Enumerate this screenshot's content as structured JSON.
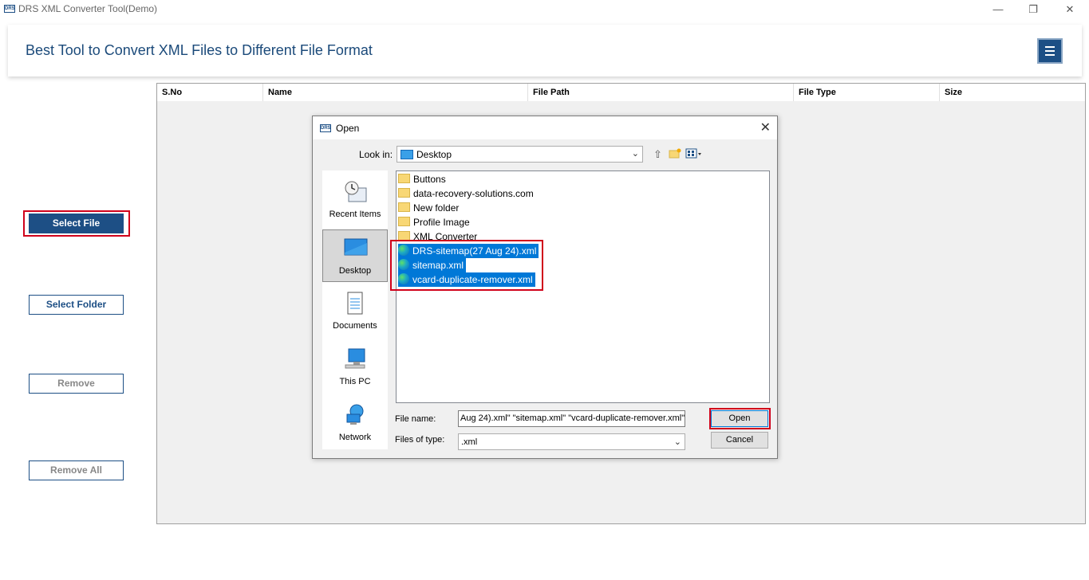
{
  "app": {
    "logo_text": "DRS",
    "title": "DRS XML Converter Tool(Demo)",
    "banner_title": "Best Tool to Convert XML Files to Different File Format",
    "window_controls": {
      "minimize": "—",
      "restore": "❐",
      "close": "✕"
    }
  },
  "sidebar": {
    "select_file": "Select File",
    "select_folder": "Select Folder",
    "remove": "Remove",
    "remove_all": "Remove All"
  },
  "grid": {
    "columns": [
      "S.No",
      "Name",
      "File Path",
      "File Type",
      "Size"
    ]
  },
  "dialog": {
    "logo_text": "DRS",
    "title": "Open",
    "close": "✕",
    "look_in_label": "Look in:",
    "look_in_value": "Desktop",
    "places": [
      "Recent Items",
      "Desktop",
      "Documents",
      "This PC",
      "Network"
    ],
    "selected_place": "Desktop",
    "items": [
      {
        "name": "Buttons",
        "type": "folder",
        "selected": false
      },
      {
        "name": "data-recovery-solutions.com",
        "type": "folder",
        "selected": false
      },
      {
        "name": "New folder",
        "type": "folder",
        "selected": false
      },
      {
        "name": "Profile Image",
        "type": "folder",
        "selected": false
      },
      {
        "name": "XML Converter",
        "type": "folder",
        "selected": false
      },
      {
        "name": "DRS-sitemap(27 Aug 24).xml",
        "type": "xml",
        "selected": true
      },
      {
        "name": "sitemap.xml",
        "type": "xml",
        "selected": true
      },
      {
        "name": "vcard-duplicate-remover.xml",
        "type": "xml",
        "selected": true
      }
    ],
    "file_name_label": "File name:",
    "file_name_value": "Aug 24).xml\" \"sitemap.xml\" \"vcard-duplicate-remover.xml\"",
    "files_of_type_label": "Files of type:",
    "files_of_type_value": ".xml",
    "open_button": "Open",
    "cancel_button": "Cancel"
  },
  "colors": {
    "brand": "#1d4f85",
    "highlight": "#d0021b",
    "selection": "#0078d7"
  }
}
